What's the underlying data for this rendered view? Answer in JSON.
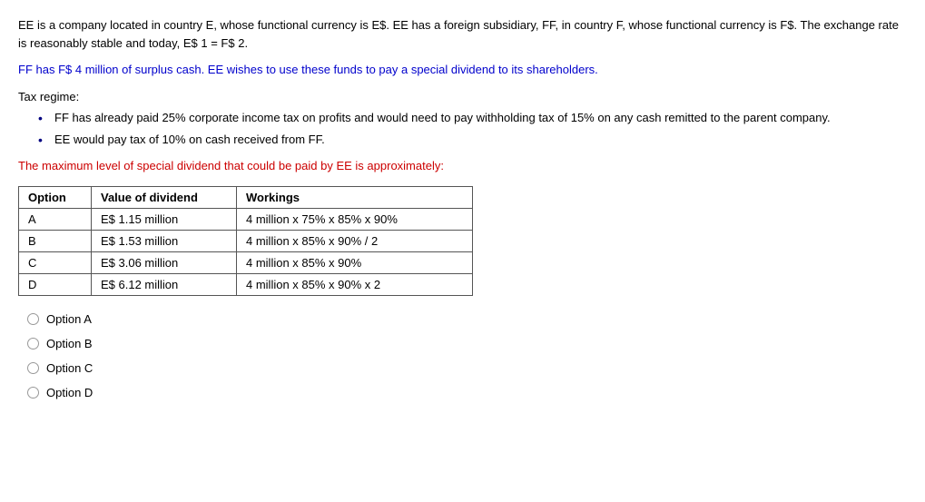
{
  "intro": {
    "paragraph1": "EE is a company located in country E, whose functional currency is E$. EE has a foreign subsidiary, FF, in country F, whose functional currency is F$. The exchange rate is reasonably stable and today, E$ 1 = F$ 2.",
    "paragraph2_blue": "FF has F$ 4 million of surplus cash. EE wishes to use these funds to pay a special dividend to its shareholders.",
    "tax_regime_label": "Tax regime:",
    "bullet1": "FF has already paid 25% corporate income tax on profits and would need to pay withholding tax of 15% on any cash remitted to the parent company.",
    "bullet2": "EE would pay tax of 10% on cash received from FF."
  },
  "question": {
    "text": "The maximum level of special dividend that could be paid by EE is approximately:"
  },
  "table": {
    "headers": [
      "Option",
      "Value of dividend",
      "Workings"
    ],
    "rows": [
      {
        "option": "A",
        "value": "E$ 1.15 million",
        "workings": "4 million x 75% x 85% x 90%"
      },
      {
        "option": "B",
        "value": "E$ 1.53 million",
        "workings": "4 million x 85% x 90% / 2"
      },
      {
        "option": "C",
        "value": "E$ 3.06 million",
        "workings": "4 million x 85% x 90%"
      },
      {
        "option": "D",
        "value": "E$ 6.12 million",
        "workings": "4 million x 85% x 90% x 2"
      }
    ]
  },
  "options": [
    {
      "id": "A",
      "label": "Option A"
    },
    {
      "id": "B",
      "label": "Option B"
    },
    {
      "id": "C",
      "label": "Option C"
    },
    {
      "id": "D",
      "label": "Option D"
    }
  ]
}
